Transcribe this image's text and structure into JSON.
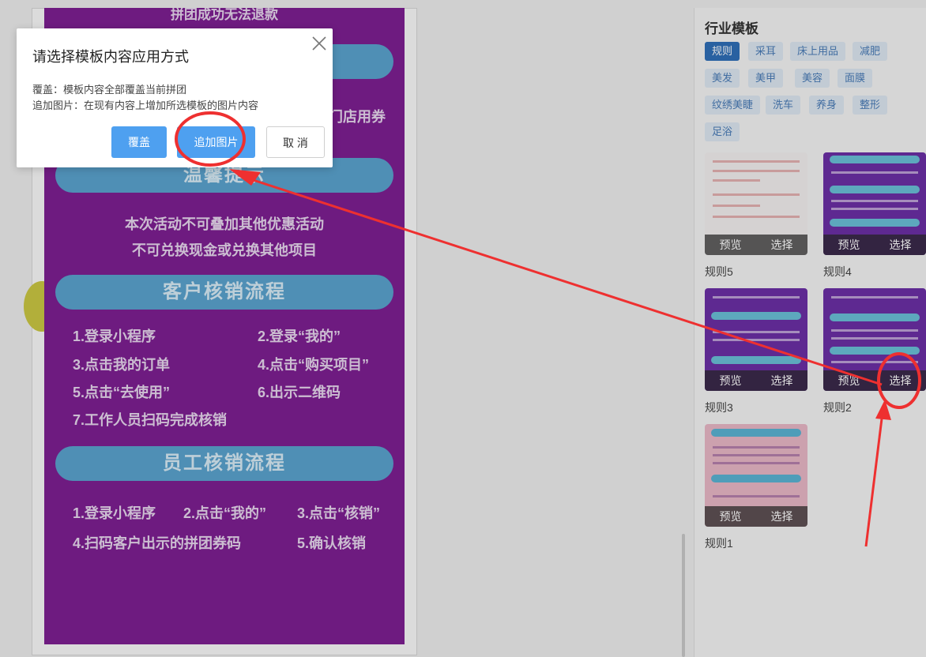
{
  "poster": {
    "top_text": "拼团成功无法退款",
    "coupon_fragment": "门店用券",
    "sections": {
      "warm_tip": "温馨提示",
      "customer_flow": "客户核销流程",
      "staff_flow": "员工核销流程"
    },
    "warm_lines": [
      "本次活动不可叠加其他优惠活动",
      "不可兑换现金或兑换其他项目"
    ],
    "customer_steps": [
      "1.登录小程序",
      "2.登录“我的”",
      "3.点击我的订单",
      "4.点击“购买项目”",
      "5.点击“去使用”",
      "6.出示二维码",
      "7.工作人员扫码完成核销"
    ],
    "staff_steps": [
      "1.登录小程序",
      "2.点击“我的”",
      "3.点击“核销”",
      "4.扫码客户出示的拼团券码",
      "5.确认核销"
    ]
  },
  "right_panel": {
    "title": "行业模板",
    "tags": [
      "规则",
      "采耳",
      "床上用品",
      "减肥",
      "美发",
      "美甲",
      "美容",
      "面膜",
      "纹绣美睫",
      "洗车",
      "养身",
      "整形",
      "足浴"
    ],
    "active_tag": "规则",
    "card_preview_label": "预览",
    "card_select_label": "选择",
    "cards": [
      "规则5",
      "规则4",
      "规则3",
      "规则2",
      "规则1"
    ]
  },
  "dialog": {
    "title": "请选择模板内容应用方式",
    "line_cover": "覆盖：模板内容全部覆盖当前拼团",
    "line_append": "追加图片：在现有内容上增加所选模板的图片内容",
    "btn_cover": "覆盖",
    "btn_append": "追加图片",
    "btn_cancel": "取 消"
  },
  "colors": {
    "poster_bg": "#7e1f92",
    "section_pill": "#5aa3cf",
    "primary_button": "#4ea0f0",
    "active_tag": "#2f6fb8",
    "annotation": "#ee3030"
  },
  "icons": {
    "close": "close-icon"
  }
}
